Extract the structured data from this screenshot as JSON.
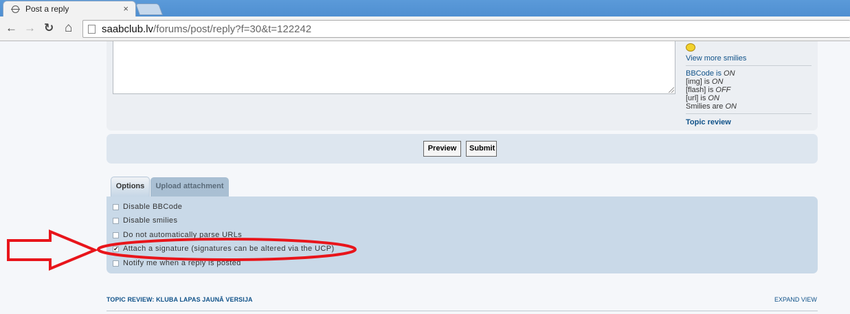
{
  "browser": {
    "tab_title": "Post a reply",
    "tab_close": "×",
    "url_host": "saabclub.lv",
    "url_path": "/forums/post/reply?f=30&t=122242",
    "back_glyph": "←",
    "forward_glyph": "→",
    "reload_glyph": "↻",
    "home_glyph": "⌂"
  },
  "sidebar": {
    "view_more_smilies": "View more smilies",
    "bbcode_label": "BBCode is ",
    "bbcode_state": "ON",
    "img_label": "[img] is ",
    "img_state": "ON",
    "flash_label": "[flash] is ",
    "flash_state": "OFF",
    "url_label": "[url] is ",
    "url_state": "ON",
    "smilies_label": "Smilies are ",
    "smilies_state": "ON",
    "topic_review": "Topic review"
  },
  "buttons": {
    "preview": "Preview",
    "submit": "Submit"
  },
  "tabs": {
    "options": "Options",
    "upload": "Upload attachment"
  },
  "options": [
    {
      "label": "Disable BBCode",
      "checked": false
    },
    {
      "label": "Disable smilies",
      "checked": false
    },
    {
      "label": "Do not automatically parse URLs",
      "checked": false
    },
    {
      "label": "Attach a signature (signatures can be altered via the UCP)",
      "checked": true
    },
    {
      "label": "Notify me when a reply is posted",
      "checked": false
    }
  ],
  "footer": {
    "topic_review_title": "TOPIC REVIEW: KLUBA LAPAS JAUNĀ VERSIJA",
    "expand_view": "EXPAND VIEW"
  },
  "annotation": {
    "color": "#e8151b"
  }
}
